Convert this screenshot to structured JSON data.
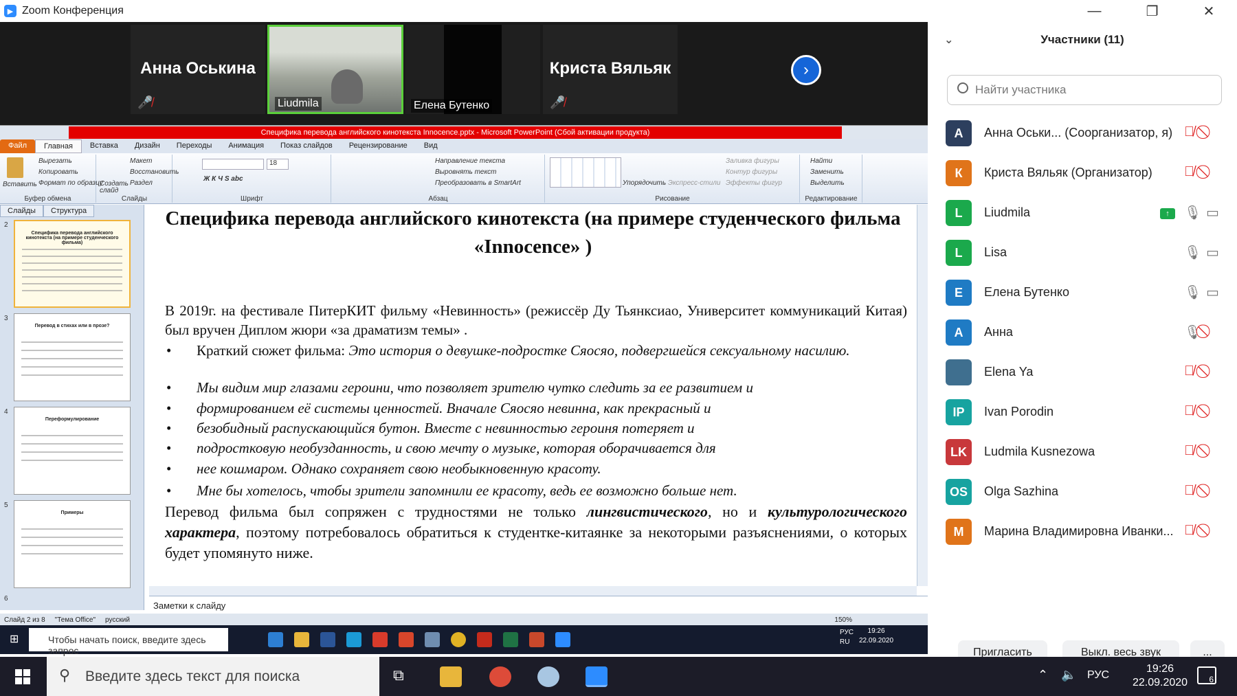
{
  "window": {
    "title": "Zoom Конференция",
    "controls": [
      "—",
      "❐",
      "✕"
    ]
  },
  "strip": {
    "tiles": [
      {
        "name": "Анна Оськина",
        "muted": true
      },
      {
        "label": "Liudmila"
      },
      {
        "label": "Елена Бутенко"
      },
      {
        "name": "Криста Вяльяк",
        "muted": true
      }
    ],
    "next_icon": "›"
  },
  "ppt": {
    "title_bar": "Специфика перевода английского  кинотекста Innocence.pptx - Microsoft PowerPoint (Сбой активации продукта)",
    "tabs": [
      "Файл",
      "Главная",
      "Вставка",
      "Дизайн",
      "Переходы",
      "Анимация",
      "Показ слайдов",
      "Рецензирование",
      "Вид"
    ],
    "ribbon": {
      "clipboard": {
        "caption": "Буфер обмена",
        "paste": "Вставить",
        "cut": "Вырезать",
        "copy": "Копировать",
        "format": "Формат по образцу"
      },
      "slides": {
        "caption": "Слайды",
        "new": "Создать слайд",
        "layout": "Макет",
        "reset": "Восстановить",
        "section": "Раздел"
      },
      "font": {
        "caption": "Шрифт",
        "size": "18"
      },
      "paragraph": {
        "caption": "Абзац",
        "dir": "Направление текста",
        "align": "Выровнять текст",
        "smartart": "Преобразовать в SmartArt"
      },
      "drawing": {
        "caption": "Рисование",
        "arrange": "Упорядочить",
        "styles": "Экспресс-стили",
        "fill": "Заливка фигуры",
        "outline": "Контур фигуры",
        "effects": "Эффекты фигур"
      },
      "editing": {
        "caption": "Редактирование",
        "find": "Найти",
        "replace": "Заменить",
        "select": "Выделить"
      }
    },
    "pane_tabs": [
      "Слайды",
      "Структура"
    ],
    "thumb_numbers": [
      "2",
      "3",
      "4",
      "5",
      "6"
    ],
    "thumb_titles": [
      "Специфика перевода английского кинотекста (на примере студенческого фильма)",
      "Перевод в стихах или в прозе?",
      "Переформулирование",
      "Примеры"
    ],
    "slide": {
      "title": "Специфика перевода английского  кинотекста (на примере студенческого фильма «Innocence» )",
      "p1": "В 2019г. на фестивале ПитерКИТ фильму «Невинность» (режиссёр Ду Тьянксиао, Университет коммуникаций Китая) был вручен Диплом жюри «за драматизм темы» .",
      "bullet1_label": "Краткий сюжет фильма: ",
      "bullet1_text": "Это история о девушке-подростке Сяосяо, подвергшейся сексуальному насилию.",
      "bullets": [
        "Мы видим мир глазами героини, что позволяет зрителю чутко следить за ее развитием и",
        "формированием её системы ценностей. Вначале Сяосяо невинна, как прекрасный и",
        "безобидный распускающийся бутон. Вместе с невинностью героиня потеряет и",
        "подростковую необузданность, и свою мечту о музыке, которая оборачивается для",
        "нее кошмаром. Однако сохраняет свою необыкновенную красоту.",
        "Мне бы хотелось, чтобы зрители запомнили ее красоту, ведь ее возможно больше нет."
      ],
      "bullet_dot": "•",
      "p2_a": "Перевод фильма был сопряжен с трудностями не только ",
      "p2_b": "лингвистического",
      "p2_c": ", но и ",
      "p2_d": "культурологического характера",
      "p2_e": ", поэтому потребовалось обратиться к студентке-китаянке за некоторыми разъяснениями, о которых будет упомянуто ниже."
    },
    "notes": "Заметки к слайду",
    "status": {
      "slide": "Слайд 2 из 8",
      "theme": "\"Тема Office\"",
      "lang": "русский",
      "zoom": "150%"
    }
  },
  "inner_taskbar": {
    "search": "Чтобы начать поиск, введите здесь запрос",
    "lang": "РУС\nRU",
    "time": "19:26",
    "date": "22.09.2020"
  },
  "panel": {
    "title": "Участники (11)",
    "search_placeholder": "Найти участника",
    "participants": [
      {
        "initials": "А",
        "color": "#2d3f5e",
        "name": "Анна Оськи...  (Соорганизатор, я)",
        "mic": "muted",
        "cam": "off"
      },
      {
        "initials": "К",
        "color": "#e0741a",
        "name": "Криста Вяльяк (Организатор)",
        "mic": "muted",
        "cam": "off"
      },
      {
        "initials": "L",
        "color": "#1ba94c",
        "name": "Liudmila",
        "mic": "on",
        "cam": "on",
        "share": true
      },
      {
        "initials": "L",
        "color": "#1ba94c",
        "name": "Lisa",
        "mic": "on",
        "cam": "on"
      },
      {
        "initials": "Е",
        "color": "#1f7bc4",
        "name": "Елена Бутенко",
        "mic": "on",
        "cam": "on"
      },
      {
        "initials": "А",
        "color": "#1f7bc4",
        "name": "Анна",
        "mic": "on",
        "cam": "off"
      },
      {
        "initials": "",
        "color": "#3f6f8f",
        "name": "Elena Ya",
        "mic": "muted",
        "cam": "off"
      },
      {
        "initials": "IP",
        "color": "#17a3a0",
        "name": "Ivan Porodin",
        "mic": "muted",
        "cam": "off"
      },
      {
        "initials": "LK",
        "color": "#c8383b",
        "name": "Ludmila Kusnezowa",
        "mic": "muted",
        "cam": "off"
      },
      {
        "initials": "OS",
        "color": "#17a3a0",
        "name": "Olga Sazhina",
        "mic": "muted",
        "cam": "off"
      },
      {
        "initials": "M",
        "color": "#e0741a",
        "name": "Марина Владимировна Иванки...",
        "mic": "muted",
        "cam": "off"
      }
    ],
    "buttons": {
      "invite": "Пригласить",
      "mute_all": "Выкл. весь звук",
      "more": "..."
    }
  },
  "os_taskbar": {
    "search": "Введите здесь текст для поиска",
    "lang": "РУС",
    "time": "19:26",
    "date": "22.09.2020",
    "notifications": "6"
  }
}
